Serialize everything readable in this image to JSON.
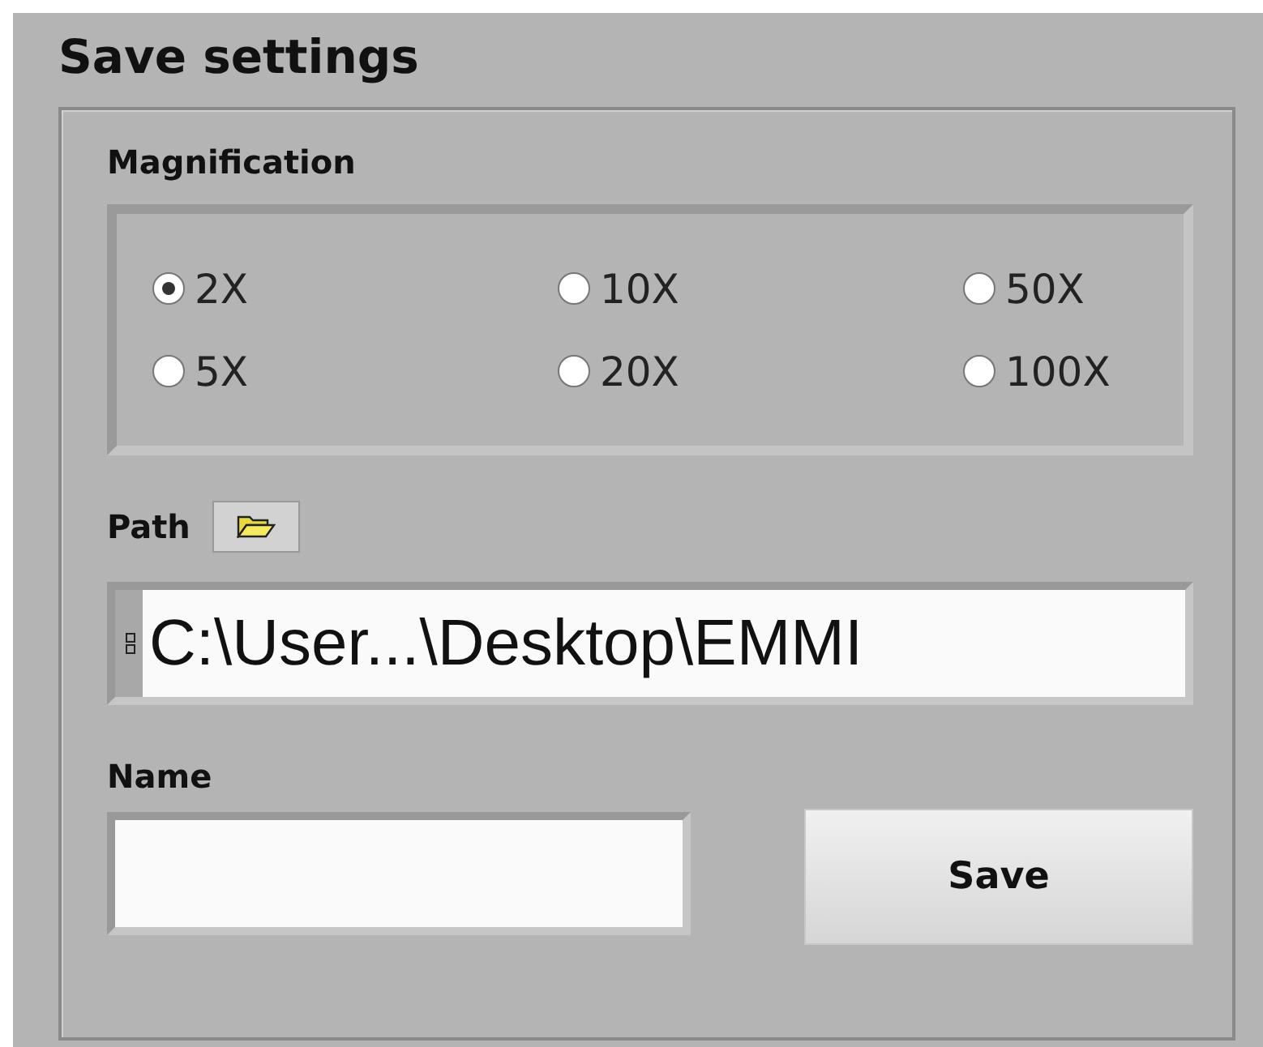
{
  "title": "Save settings",
  "magnification": {
    "label": "Magnification",
    "options": [
      {
        "label": "2X",
        "selected": true
      },
      {
        "label": "10X",
        "selected": false
      },
      {
        "label": "50X",
        "selected": false
      },
      {
        "label": "5X",
        "selected": false
      },
      {
        "label": "20X",
        "selected": false
      },
      {
        "label": "100X",
        "selected": false
      }
    ]
  },
  "path": {
    "label": "Path",
    "value": "C:\\User...\\Desktop\\EMMI"
  },
  "name": {
    "label": "Name"
  },
  "save_button": "Save"
}
